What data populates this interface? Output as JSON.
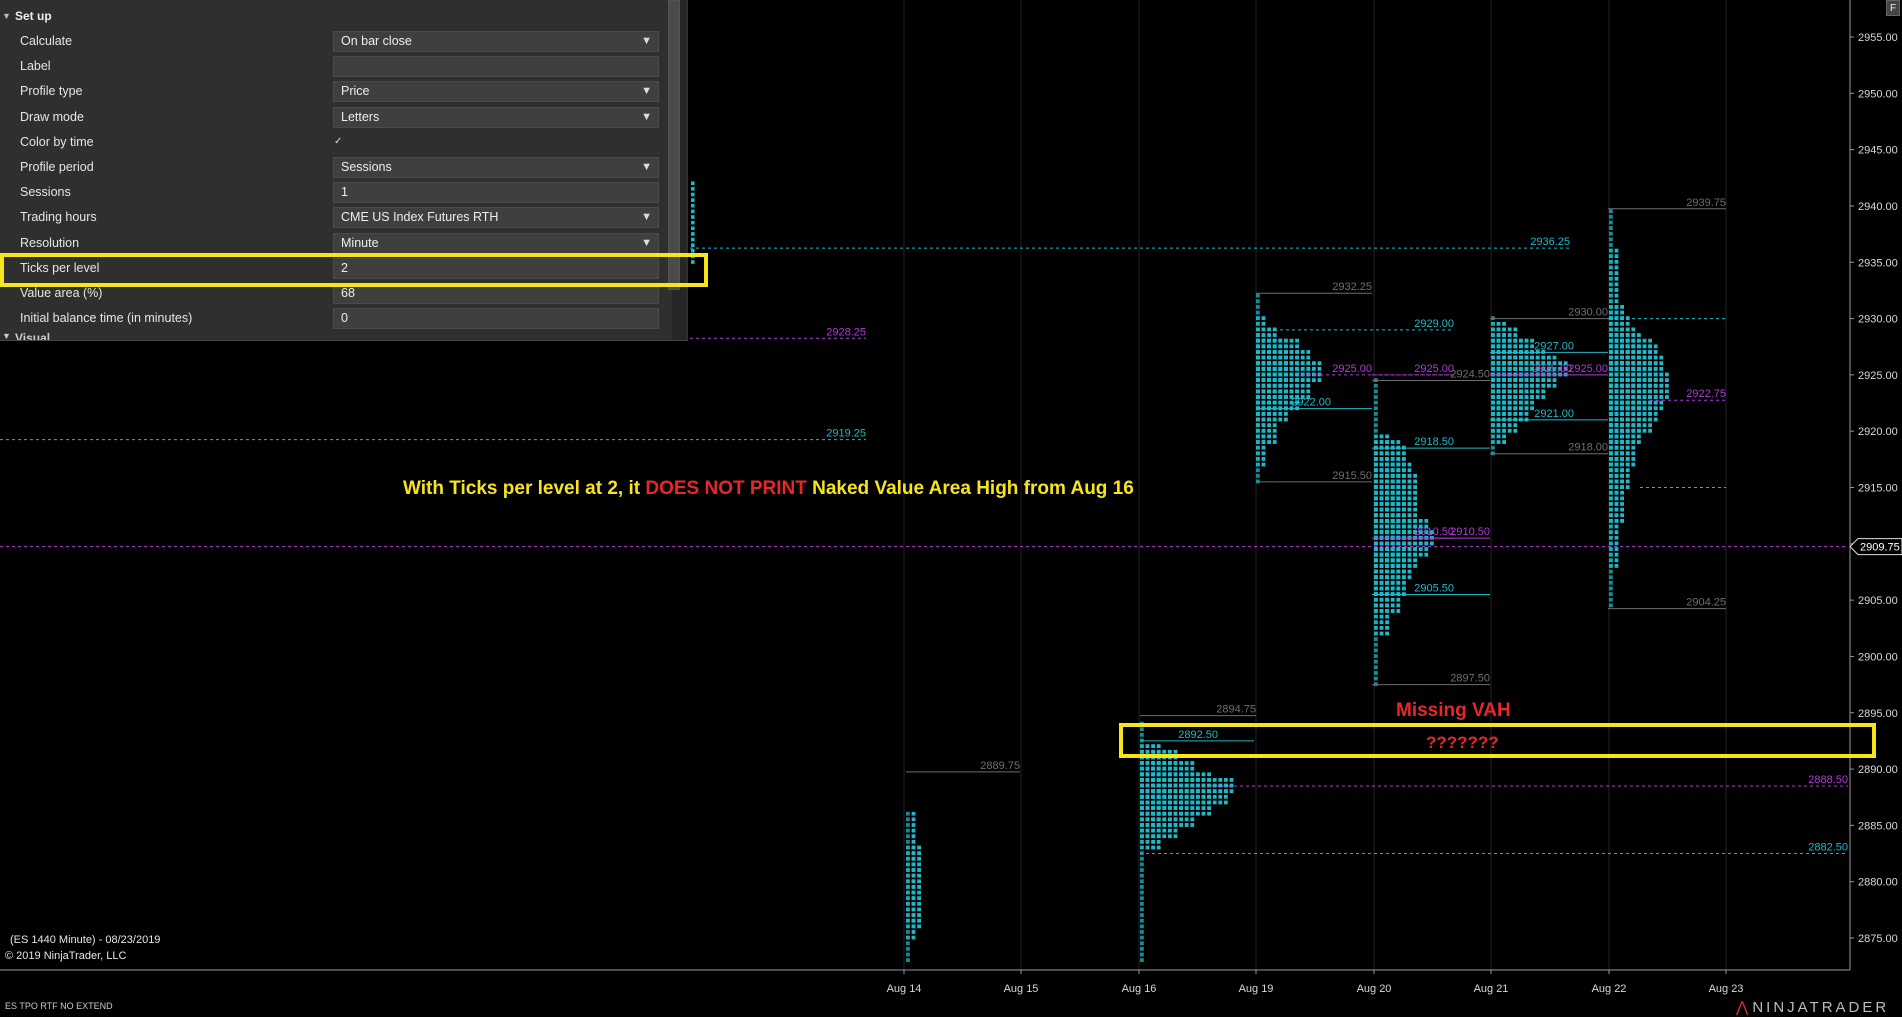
{
  "properties": {
    "section_setup": "Set up",
    "section_visual": "Visual",
    "rows": [
      {
        "label": "Calculate",
        "value": "On bar close",
        "dropdown": true
      },
      {
        "label": "Label",
        "value": "",
        "dropdown": false
      },
      {
        "label": "Profile type",
        "value": "Price",
        "dropdown": true
      },
      {
        "label": "Draw mode",
        "value": "Letters",
        "dropdown": true
      },
      {
        "label": "Color by time",
        "value": "✓",
        "checkbox": true
      },
      {
        "label": "Profile period",
        "value": "Sessions",
        "dropdown": true
      },
      {
        "label": "Sessions",
        "value": "1",
        "dropdown": false
      },
      {
        "label": "Trading hours",
        "value": "CME US Index Futures RTH",
        "dropdown": true
      },
      {
        "label": "Resolution",
        "value": "Minute",
        "dropdown": true
      },
      {
        "label": "Ticks per level",
        "value": "2",
        "dropdown": false
      },
      {
        "label": "Value area (%)",
        "value": "68",
        "dropdown": false
      },
      {
        "label": "Initial balance time (in minutes)",
        "value": "0",
        "dropdown": false
      }
    ]
  },
  "annotations": {
    "main_prefix": "With Ticks per level at 2, it ",
    "main_red": "DOES NOT  PRINT",
    "main_suffix": " Naked Value Area High from Aug 16",
    "missing_vah": "Missing VAH",
    "question": "???????"
  },
  "info": {
    "instrument": "(ES 1440 Minute) - 08/23/2019",
    "copyright": "© 2019 NinjaTrader, LLC",
    "indicator_name": "ES TPO RTF NO EXTEND",
    "logo": "NINJATRADER",
    "logo_mark": "⋀",
    "corner_button": "F"
  },
  "colors": {
    "cyan": "#1fb8c8",
    "magenta": "#b03ad8",
    "gray_label": "#6e6e6e",
    "highlight": "#f5e51a",
    "red_text": "#e8262b"
  },
  "chart_data": {
    "type": "tpo-profile",
    "y_ticks": [
      2955,
      2950,
      2945,
      2940,
      2935,
      2930,
      2925,
      2920,
      2915,
      2910,
      2905,
      2900,
      2895,
      2890,
      2885,
      2880,
      2875
    ],
    "y_tick_labels": [
      "2955.00",
      "2950.00",
      "2945.00",
      "2940.00",
      "2935.00",
      "2930.00",
      "2925.00",
      "2920.00",
      "2915.00",
      "2910.00",
      "2905.00",
      "2900.00",
      "2895.00",
      "2890.00",
      "2885.00",
      "2880.00",
      "2875.00"
    ],
    "ylim": [
      2872.8,
      2958.2
    ],
    "x_labels": [
      "Aug 14",
      "Aug 15",
      "Aug 16",
      "Aug 19",
      "Aug 20",
      "Aug 21",
      "Aug 22",
      "Aug 23"
    ],
    "current_price": {
      "value": 2909.75,
      "label": "2909.75"
    },
    "profiles": [
      {
        "date": "Aug 14",
        "low": 2873,
        "high": 2889.75,
        "widths": [
          [
            2873,
            2875,
            1
          ],
          [
            2875,
            2886,
            2
          ],
          [
            2876,
            2883,
            3
          ]
        ]
      },
      {
        "date": "Aug 16",
        "low": 2873,
        "high": 2894.75,
        "widths": [
          [
            2873,
            2894,
            1
          ],
          [
            2883,
            2892,
            4
          ],
          [
            2884,
            2891.5,
            7
          ],
          [
            2885,
            2890.5,
            10
          ],
          [
            2886,
            2889.5,
            13
          ],
          [
            2887,
            2888.5,
            16
          ],
          [
            2888,
            2889,
            17
          ]
        ]
      },
      {
        "date": "Aug 19",
        "low": 2915.5,
        "high": 2932.25,
        "widths": [
          [
            2915.5,
            2932,
            1
          ],
          [
            2917,
            2930,
            2
          ],
          [
            2919,
            2929,
            4
          ],
          [
            2921,
            2928,
            6
          ],
          [
            2922,
            2928,
            8
          ],
          [
            2923,
            2927,
            10
          ],
          [
            2924.5,
            2926,
            12
          ]
        ]
      },
      {
        "date": "Aug 20",
        "low": 2897.5,
        "high": 2924.5,
        "widths": [
          [
            2897.5,
            2924.5,
            1
          ],
          [
            2902,
            2919.5,
            3
          ],
          [
            2904,
            2919,
            5
          ],
          [
            2905.5,
            2918.5,
            6
          ],
          [
            2907,
            2917,
            7
          ],
          [
            2908,
            2916,
            8
          ],
          [
            2909,
            2912,
            10
          ],
          [
            2910,
            2911,
            11
          ]
        ]
      },
      {
        "date": "Aug 21",
        "low": 2918,
        "high": 2930,
        "widths": [
          [
            2918,
            2930,
            1
          ],
          [
            2919,
            2929.5,
            3
          ],
          [
            2920,
            2929,
            5
          ],
          [
            2921,
            2928,
            7
          ],
          [
            2922,
            2928,
            8
          ],
          [
            2923,
            2927,
            10
          ],
          [
            2924,
            2926.5,
            12
          ],
          [
            2925,
            2926,
            14
          ]
        ]
      },
      {
        "date": "Aug 22",
        "low": 2904.25,
        "high": 2939.75,
        "widths": [
          [
            2904.5,
            2939.5,
            1
          ],
          [
            2908,
            2936,
            2
          ],
          [
            2912,
            2931,
            3
          ],
          [
            2915,
            2930,
            4
          ],
          [
            2917,
            2929,
            5
          ],
          [
            2919,
            2928.5,
            6
          ],
          [
            2920,
            2928,
            8
          ],
          [
            2921,
            2927.5,
            9
          ],
          [
            2922,
            2926.5,
            10
          ],
          [
            2923,
            2925,
            11
          ]
        ]
      }
    ],
    "levels": [
      {
        "label": "2928.25",
        "price": 2928.25,
        "color": "magenta",
        "x_from": 690,
        "x_to": 866,
        "label_x": 866,
        "dashed": true
      },
      {
        "label": "2919.25",
        "price": 2919.25,
        "color": "cyan",
        "x_from": 0,
        "x_to": 866,
        "label_x": 866,
        "dashed": true
      },
      {
        "label": "2936.25",
        "price": 2936.25,
        "color": "cyan",
        "x_from": 690,
        "x_to": 1570,
        "label_x": 1570,
        "dashed": true
      },
      {
        "label": "2889.75",
        "price": 2889.75,
        "color": "gray",
        "x_from": 906,
        "x_to": 1020,
        "label_x": 1020,
        "dashed": false
      },
      {
        "label": "2894.75",
        "price": 2894.75,
        "color": "gray",
        "x_from": 1140,
        "x_to": 1256,
        "label_x": 1256,
        "dashed": false
      },
      {
        "label": "2892.50",
        "price": 2892.5,
        "color": "cyan",
        "x_from": 1140,
        "x_to": 1254,
        "label_x": 1218,
        "dashed": false
      },
      {
        "label": "2888.50",
        "price": 2888.5,
        "color": "magenta",
        "x_from": 1210,
        "x_to": 1848,
        "label_x": 1848,
        "dashed": true
      },
      {
        "label": "2882.50",
        "price": 2882.5,
        "color": "cyan",
        "x_from": 1140,
        "x_to": 1848,
        "label_x": 1848,
        "dashed": true
      },
      {
        "label": "2932.25",
        "price": 2932.25,
        "color": "gray",
        "x_from": 1256,
        "x_to": 1372,
        "label_x": 1372,
        "dashed": false
      },
      {
        "label": "2929.00",
        "price": 2929.0,
        "color": "cyan",
        "x_from": 1256,
        "x_to": 1454,
        "label_x": 1454,
        "dashed": true
      },
      {
        "label": "2925.00",
        "price": 2925.0,
        "color": "magenta",
        "x_from": 1302,
        "x_to": 1454,
        "label_x": 1372,
        "dashed": true
      },
      {
        "label": "2922.00",
        "price": 2922.0,
        "color": "cyan",
        "x_from": 1256,
        "x_to": 1372,
        "label_x": 1331,
        "dashed": false
      },
      {
        "label": "2915.50",
        "price": 2915.5,
        "color": "gray",
        "x_from": 1256,
        "x_to": 1372,
        "label_x": 1372,
        "dashed": false
      },
      {
        "label": "2925.00",
        "price": 2925.0,
        "color": "magenta",
        "x_from": 1372,
        "x_to": 1454,
        "label_x": 1454,
        "dashed": true
      },
      {
        "label": "2924.50",
        "price": 2924.5,
        "color": "gray",
        "x_from": 1372,
        "x_to": 1490,
        "label_x": 1490,
        "dashed": false
      },
      {
        "label": "2918.50",
        "price": 2918.5,
        "color": "cyan",
        "x_from": 1372,
        "x_to": 1490,
        "label_x": 1454,
        "dashed": false
      },
      {
        "label": "2910.50",
        "price": 2910.5,
        "color": "magenta",
        "x_from": 1372,
        "x_to": 1454,
        "label_x": 1454,
        "dashed": false
      },
      {
        "label": "2910.50",
        "price": 2910.5,
        "color": "magenta",
        "x_from": 1408,
        "x_to": 1490,
        "label_x": 1490,
        "dashed": false
      },
      {
        "label": "2905.50",
        "price": 2905.5,
        "color": "cyan",
        "x_from": 1372,
        "x_to": 1490,
        "label_x": 1454,
        "dashed": false
      },
      {
        "label": "2897.50",
        "price": 2897.5,
        "color": "gray",
        "x_from": 1372,
        "x_to": 1490,
        "label_x": 1490,
        "dashed": false
      },
      {
        "label": "2930.00",
        "price": 2930.0,
        "color": "gray",
        "x_from": 1490,
        "x_to": 1608,
        "label_x": 1608,
        "dashed": false
      },
      {
        "label": "2927.00",
        "price": 2927.0,
        "color": "cyan",
        "x_from": 1490,
        "x_to": 1608,
        "label_x": 1574,
        "dashed": false
      },
      {
        "label": "2925.00",
        "price": 2925.0,
        "color": "magenta",
        "x_from": 1490,
        "x_to": 1572,
        "label_x": 1572,
        "dashed": false
      },
      {
        "label": "2925.00",
        "price": 2925.0,
        "color": "magenta",
        "x_from": 1572,
        "x_to": 1608,
        "label_x": 1608,
        "dashed": false
      },
      {
        "label": "2921.00",
        "price": 2921.0,
        "color": "cyan",
        "x_from": 1490,
        "x_to": 1608,
        "label_x": 1574,
        "dashed": false
      },
      {
        "label": "2918.00",
        "price": 2918.0,
        "color": "gray",
        "x_from": 1490,
        "x_to": 1608,
        "label_x": 1608,
        "dashed": false
      },
      {
        "label": "2939.75",
        "price": 2939.75,
        "color": "gray",
        "x_from": 1608,
        "x_to": 1726,
        "label_x": 1726,
        "dashed": false
      },
      {
        "label": "2922.75",
        "price": 2922.75,
        "color": "magenta",
        "x_from": 1650,
        "x_to": 1726,
        "label_x": 1726,
        "dashed": true
      },
      {
        "label": "2904.25",
        "price": 2904.25,
        "color": "gray",
        "x_from": 1608,
        "x_to": 1726,
        "label_x": 1726,
        "dashed": false
      },
      {
        "label": "",
        "price": 2930.0,
        "color": "cyan",
        "x_from": 1608,
        "x_to": 1726,
        "label_x": 1726,
        "dashed": true
      },
      {
        "label": "",
        "price": 2915.0,
        "color": "cyan",
        "x_from": 1640,
        "x_to": 1726,
        "label_x": 1726,
        "dashed": true
      }
    ]
  }
}
